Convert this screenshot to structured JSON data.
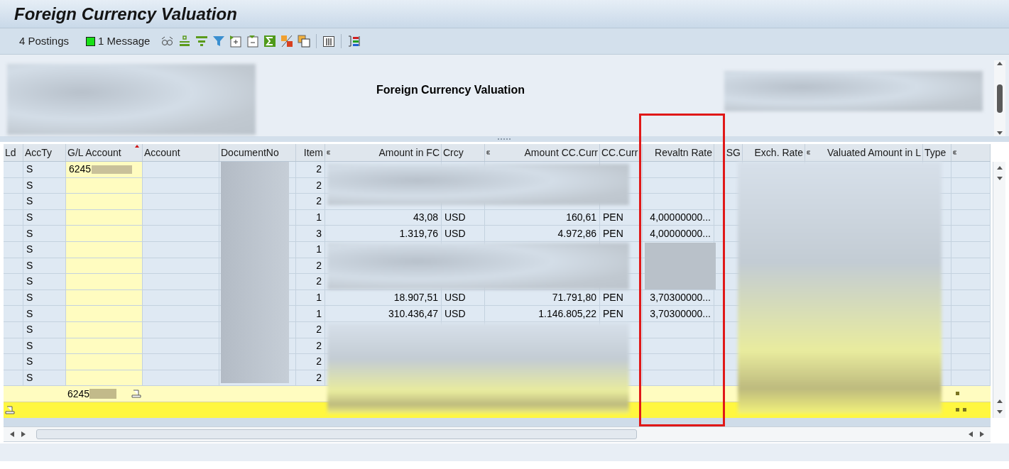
{
  "window": {
    "title": "Foreign Currency Valuation"
  },
  "toolbar": {
    "postings": "4 Postings",
    "message": "1 Message"
  },
  "report_title": "Foreign Currency Valuation",
  "table": {
    "columns": [
      {
        "label": "Ld",
        "sorted": false
      },
      {
        "label": "AccTy",
        "sorted": false
      },
      {
        "label": "G/L Account",
        "sorted": true
      },
      {
        "label": "Account",
        "sorted": false
      },
      {
        "label": "DocumentNo",
        "sorted": false
      },
      {
        "label": "Item",
        "sorted": false
      },
      {
        "label": "Amount in FC",
        "sorted": false
      },
      {
        "label": "Crcy",
        "sorted": false
      },
      {
        "label": "Amount CC.Curr",
        "sorted": false
      },
      {
        "label": "CC.Curr",
        "sorted": false
      },
      {
        "label": "Revaltn Rate",
        "sorted": false
      },
      {
        "label": "SG",
        "sorted": false
      },
      {
        "label": "Exch. Rate",
        "sorted": false
      },
      {
        "label": "Valuated Amount in L",
        "sorted": false
      },
      {
        "label": "Type",
        "sorted": false
      },
      {
        "sorted": false
      }
    ],
    "rows": [
      {
        "accty": "S",
        "gl_account": "6245",
        "item": "2"
      },
      {
        "accty": "S",
        "item": "2"
      },
      {
        "accty": "S",
        "item": "2"
      },
      {
        "accty": "S",
        "item": "1",
        "amount_fc": "43,08",
        "crcy": "USD",
        "amount_cc": "160,61",
        "cc_curr": "PEN",
        "revaltn_rate": "4,00000000..."
      },
      {
        "accty": "S",
        "item": "3",
        "amount_fc": "1.319,76",
        "crcy": "USD",
        "amount_cc": "4.972,86",
        "cc_curr": "PEN",
        "revaltn_rate": "4,00000000..."
      },
      {
        "accty": "S",
        "item": "1"
      },
      {
        "accty": "S",
        "item": "2"
      },
      {
        "accty": "S",
        "item": "2"
      },
      {
        "accty": "S",
        "item": "1",
        "amount_fc": "18.907,51",
        "crcy": "USD",
        "amount_cc": "71.791,80",
        "cc_curr": "PEN",
        "revaltn_rate": "3,70300000..."
      },
      {
        "accty": "S",
        "item": "1",
        "amount_fc": "310.436,47",
        "crcy": "USD",
        "amount_cc": "1.146.805,22",
        "cc_curr": "PEN",
        "revaltn_rate": "3,70300000..."
      },
      {
        "accty": "S",
        "item": "2"
      },
      {
        "accty": "S",
        "item": "2"
      },
      {
        "accty": "S",
        "item": "2"
      },
      {
        "accty": "S",
        "item": "2"
      }
    ],
    "subtotal": {
      "gl_account": "6245"
    }
  }
}
